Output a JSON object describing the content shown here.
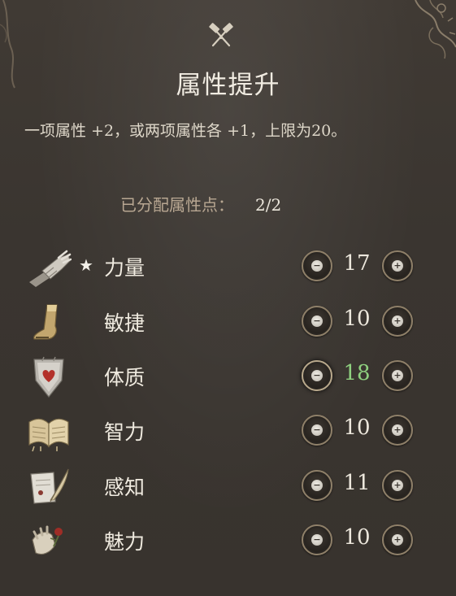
{
  "header": {
    "icon": "crossed-hammers-icon",
    "title": "属性提升",
    "description": "一项属性 +2，或两项属性各 +1，上限为20。"
  },
  "allocation": {
    "label": "已分配属性点：",
    "value": "2/2"
  },
  "attributes": [
    {
      "name": "力量",
      "icon": "gauntlet-icon",
      "starred": true,
      "star": "★",
      "value": "17",
      "boosted": false
    },
    {
      "name": "敏捷",
      "icon": "boot-icon",
      "starred": false,
      "star": "",
      "value": "10",
      "boosted": false
    },
    {
      "name": "体质",
      "icon": "heart-shield-icon",
      "starred": false,
      "star": "",
      "value": "18",
      "boosted": true
    },
    {
      "name": "智力",
      "icon": "open-book-icon",
      "starred": false,
      "star": "",
      "value": "10",
      "boosted": false
    },
    {
      "name": "感知",
      "icon": "quill-scroll-icon",
      "starred": false,
      "star": "",
      "value": "11",
      "boosted": false
    },
    {
      "name": "魅力",
      "icon": "hand-rose-icon",
      "starred": false,
      "star": "",
      "value": "10",
      "boosted": false
    }
  ],
  "controls": {
    "minus_glyph": "−",
    "plus_glyph": "+"
  },
  "colors": {
    "background": "#3b3631",
    "boosted_value": "#8fd07f",
    "points_label": "#b8a792",
    "button_rim": "#8f8069"
  }
}
